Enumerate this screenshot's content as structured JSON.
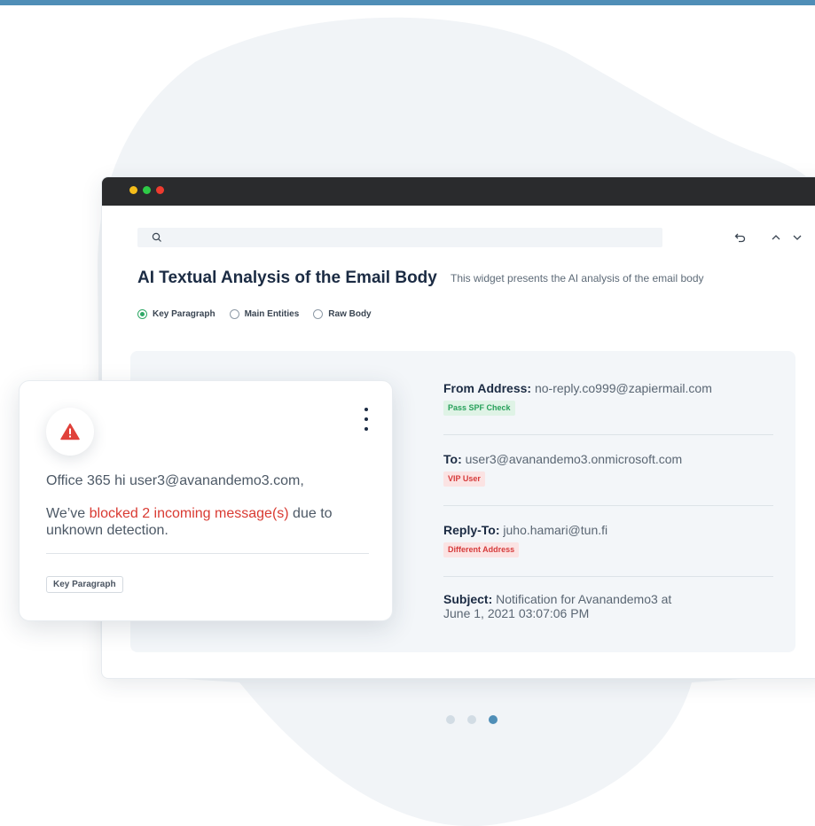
{
  "search": {
    "placeholder": ""
  },
  "widget": {
    "title": "AI Textual Analysis of the Email Body",
    "subtitle": "This widget presents the AI analysis of the email body",
    "radios": [
      {
        "label": "Key Paragraph",
        "selected": true
      },
      {
        "label": "Main Entities",
        "selected": false
      },
      {
        "label": "Raw Body",
        "selected": false
      }
    ]
  },
  "details": {
    "from": {
      "label": "From Address:",
      "value": "no-reply.co999@zapiermail.com",
      "badge": "Pass SPF Check"
    },
    "to": {
      "label": "To:",
      "value": "user3@avanandemo3.onmicrosoft.com",
      "badge": "VIP User"
    },
    "reply_to": {
      "label": "Reply-To:",
      "value": "juho.hamari@tun.fi",
      "badge": "Different Address"
    },
    "subject": {
      "label": "Subject:",
      "value_line1": "Notification for Avanandemo3 at",
      "value_line2": "June 1, 2021 03:07:06 PM"
    }
  },
  "card": {
    "line1": "Office 365 hi user3@avanandemo3.com,",
    "line2_prefix": "We’ve ",
    "line2_highlight": "blocked 2 incoming message(s)",
    "line2_suffix": " due to unknown detection.",
    "tag": "Key Paragraph"
  },
  "pager": {
    "count": 3,
    "active_index": 2
  },
  "colors": {
    "accent": "#4f8eb7",
    "danger": "#d93a32",
    "success": "#2fa866",
    "window_bar": "#2a2b2d"
  },
  "icons": [
    "search-icon",
    "undo-icon",
    "chevron-up-icon",
    "chevron-down-icon",
    "warning-icon",
    "kebab-menu-icon"
  ]
}
